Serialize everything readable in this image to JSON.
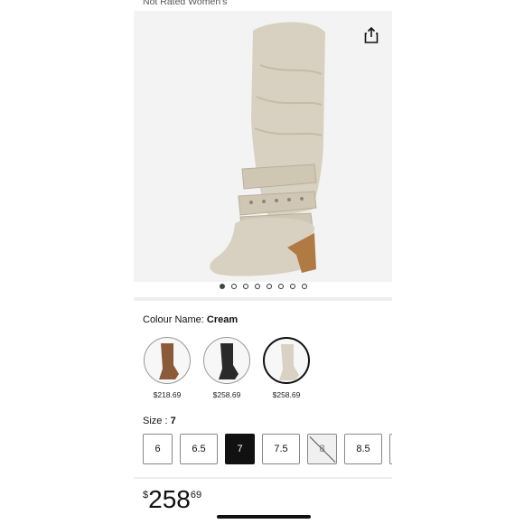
{
  "product": {
    "brand_line": "Not Rated Women's"
  },
  "carousel": {
    "count": 8,
    "active_index": 0
  },
  "colour": {
    "label": "Colour Name: ",
    "value": "Cream",
    "options": [
      {
        "name": "Brown",
        "price": "$218.69",
        "tone": "#8a5a3a"
      },
      {
        "name": "Black",
        "price": "$258.69",
        "tone": "#2a2a2a"
      },
      {
        "name": "Cream",
        "price": "$258.69",
        "tone": "#d9d2c4"
      }
    ]
  },
  "size": {
    "label": "Size : ",
    "value": "7",
    "options": [
      "6",
      "6.5",
      "7",
      "7.5",
      "8",
      "8.5"
    ]
  },
  "price": {
    "currency": "$",
    "whole": "258",
    "fraction": "69"
  },
  "colors": {
    "boot": "#d8d0c0",
    "strap": "#cfc6b4",
    "heel": "#b07a45"
  }
}
